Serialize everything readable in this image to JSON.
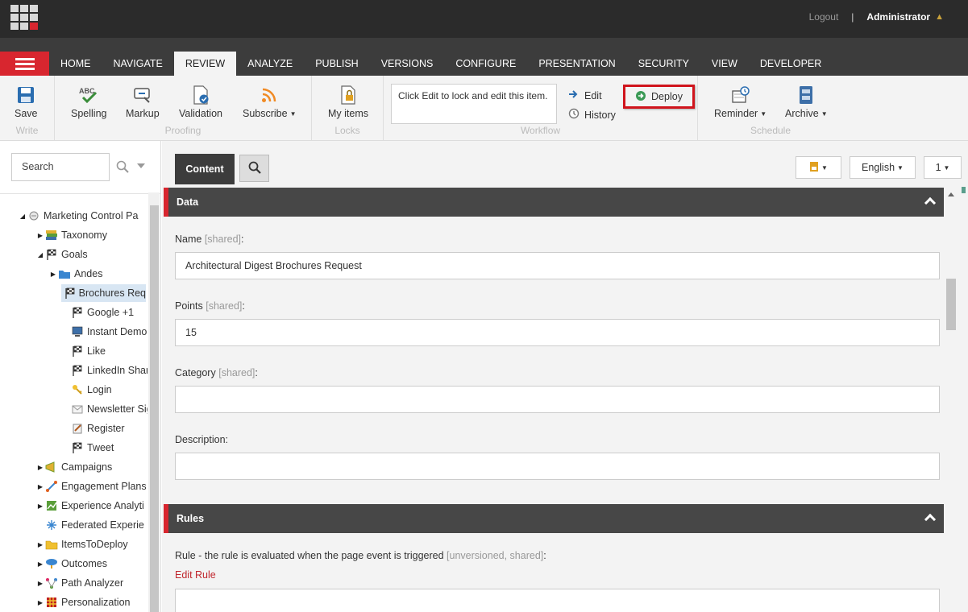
{
  "topbar": {
    "logout": "Logout",
    "separator": "|",
    "user": "Administrator"
  },
  "nav": {
    "tabs": [
      "HOME",
      "NAVIGATE",
      "REVIEW",
      "ANALYZE",
      "PUBLISH",
      "VERSIONS",
      "CONFIGURE",
      "PRESENTATION",
      "SECURITY",
      "VIEW",
      "DEVELOPER"
    ],
    "active": "REVIEW"
  },
  "ribbon": {
    "write": {
      "label": "Write",
      "save": "Save"
    },
    "proofing": {
      "label": "Proofing",
      "spelling": "Spelling",
      "markup": "Markup",
      "validation": "Validation",
      "subscribe": "Subscribe"
    },
    "locks": {
      "label": "Locks",
      "my_items": "My items"
    },
    "workflow": {
      "label": "Workflow",
      "message": "Click Edit to lock and edit this item.",
      "edit": "Edit",
      "history": "History",
      "deploy": "Deploy"
    },
    "schedule": {
      "label": "Schedule",
      "reminder": "Reminder",
      "archive": "Archive"
    }
  },
  "sidebar": {
    "search_placeholder": "Search",
    "tree": [
      {
        "label": "Marketing Control Pa",
        "icon": "marketing-icon",
        "toggle": "expanded"
      },
      {
        "label": "Taxonomy",
        "icon": "taxonomy-icon",
        "toggle": "collapsed"
      },
      {
        "label": "Goals",
        "icon": "flag-icon",
        "toggle": "expanded"
      },
      {
        "label": "Andes",
        "icon": "folder-icon",
        "toggle": "collapsed"
      },
      {
        "label": "Brochures Req",
        "icon": "flag-icon",
        "toggle": "none",
        "selected": true
      },
      {
        "label": "Google +1",
        "icon": "flag-icon",
        "toggle": "none"
      },
      {
        "label": "Instant Demo",
        "icon": "monitor-icon",
        "toggle": "none"
      },
      {
        "label": "Like",
        "icon": "flag-icon",
        "toggle": "none"
      },
      {
        "label": "LinkedIn Share",
        "icon": "flag-icon",
        "toggle": "none"
      },
      {
        "label": "Login",
        "icon": "key-icon",
        "toggle": "none"
      },
      {
        "label": "Newsletter Sign",
        "icon": "envelope-icon",
        "toggle": "none"
      },
      {
        "label": "Register",
        "icon": "register-icon",
        "toggle": "none"
      },
      {
        "label": "Tweet",
        "icon": "flag-icon",
        "toggle": "none"
      },
      {
        "label": "Campaigns",
        "icon": "campaigns-icon",
        "toggle": "collapsed"
      },
      {
        "label": "Engagement Plans",
        "icon": "engagement-icon",
        "toggle": "collapsed"
      },
      {
        "label": "Experience Analyti",
        "icon": "chart-icon",
        "toggle": "collapsed"
      },
      {
        "label": "Federated Experie",
        "icon": "federated-icon",
        "toggle": "none"
      },
      {
        "label": "ItemsToDeploy",
        "icon": "folder-yellow-icon",
        "toggle": "collapsed"
      },
      {
        "label": "Outcomes",
        "icon": "outcomes-icon",
        "toggle": "collapsed"
      },
      {
        "label": "Path Analyzer",
        "icon": "path-icon",
        "toggle": "collapsed"
      },
      {
        "label": "Personalization",
        "icon": "personalization-icon",
        "toggle": "collapsed"
      }
    ]
  },
  "main": {
    "content_tab": "Content",
    "language": "English",
    "version": "1",
    "sections": [
      {
        "title": "Data"
      },
      {
        "title": "Rules"
      }
    ],
    "fields": {
      "name": {
        "label": "Name",
        "tag": "[shared]",
        "suffix": ":",
        "value": "Architectural Digest Brochures Request"
      },
      "points": {
        "label": "Points",
        "tag": "[shared]",
        "suffix": ":",
        "value": "15"
      },
      "category": {
        "label": "Category",
        "tag": "[shared]",
        "suffix": ":",
        "value": ""
      },
      "description": {
        "label": "Description:",
        "value": ""
      },
      "rule": {
        "label": "Rule - the rule is evaluated when the page event is triggered",
        "tag": "[unversioned, shared]",
        "suffix": ":",
        "edit_link": "Edit Rule"
      }
    }
  }
}
